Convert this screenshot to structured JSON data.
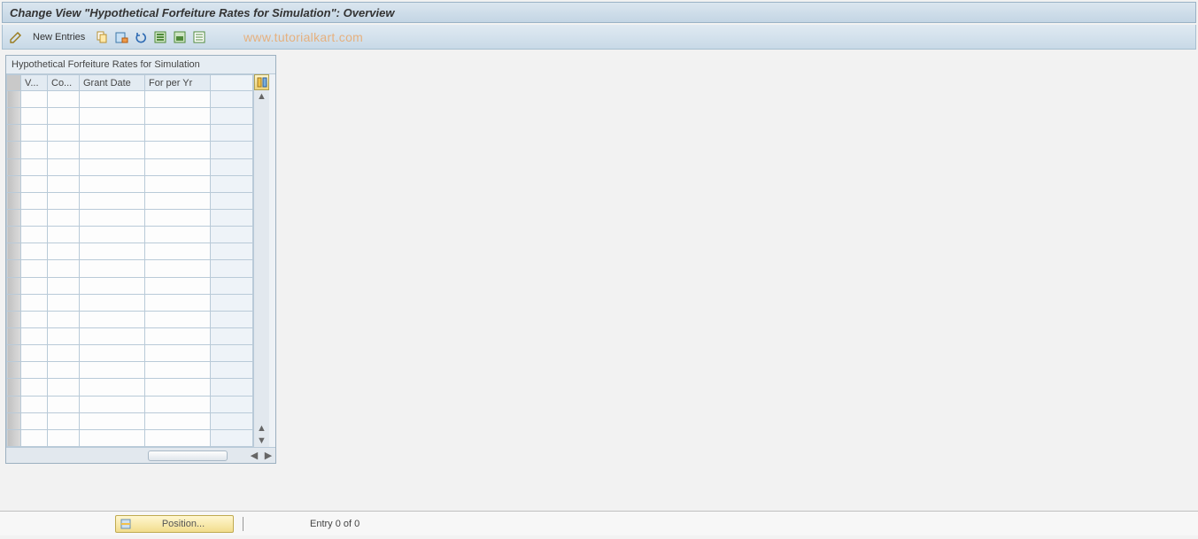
{
  "title": "Change View \"Hypothetical Forfeiture Rates for Simulation\": Overview",
  "toolbar": {
    "new_entries_label": "New Entries"
  },
  "watermark": "www.tutorialkart.com",
  "panel": {
    "title": "Hypothetical Forfeiture Rates for Simulation",
    "columns": [
      "V...",
      "Co...",
      "Grant Date",
      "For per Yr"
    ],
    "rows": [
      [
        "",
        "",
        "",
        ""
      ],
      [
        "",
        "",
        "",
        ""
      ],
      [
        "",
        "",
        "",
        ""
      ],
      [
        "",
        "",
        "",
        ""
      ],
      [
        "",
        "",
        "",
        ""
      ],
      [
        "",
        "",
        "",
        ""
      ],
      [
        "",
        "",
        "",
        ""
      ],
      [
        "",
        "",
        "",
        ""
      ],
      [
        "",
        "",
        "",
        ""
      ],
      [
        "",
        "",
        "",
        ""
      ],
      [
        "",
        "",
        "",
        ""
      ],
      [
        "",
        "",
        "",
        ""
      ],
      [
        "",
        "",
        "",
        ""
      ],
      [
        "",
        "",
        "",
        ""
      ],
      [
        "",
        "",
        "",
        ""
      ],
      [
        "",
        "",
        "",
        ""
      ],
      [
        "",
        "",
        "",
        ""
      ],
      [
        "",
        "",
        "",
        ""
      ],
      [
        "",
        "",
        "",
        ""
      ],
      [
        "",
        "",
        "",
        ""
      ],
      [
        "",
        "",
        "",
        ""
      ]
    ]
  },
  "footer": {
    "position_label": "Position...",
    "entry_status": "Entry 0 of 0"
  }
}
